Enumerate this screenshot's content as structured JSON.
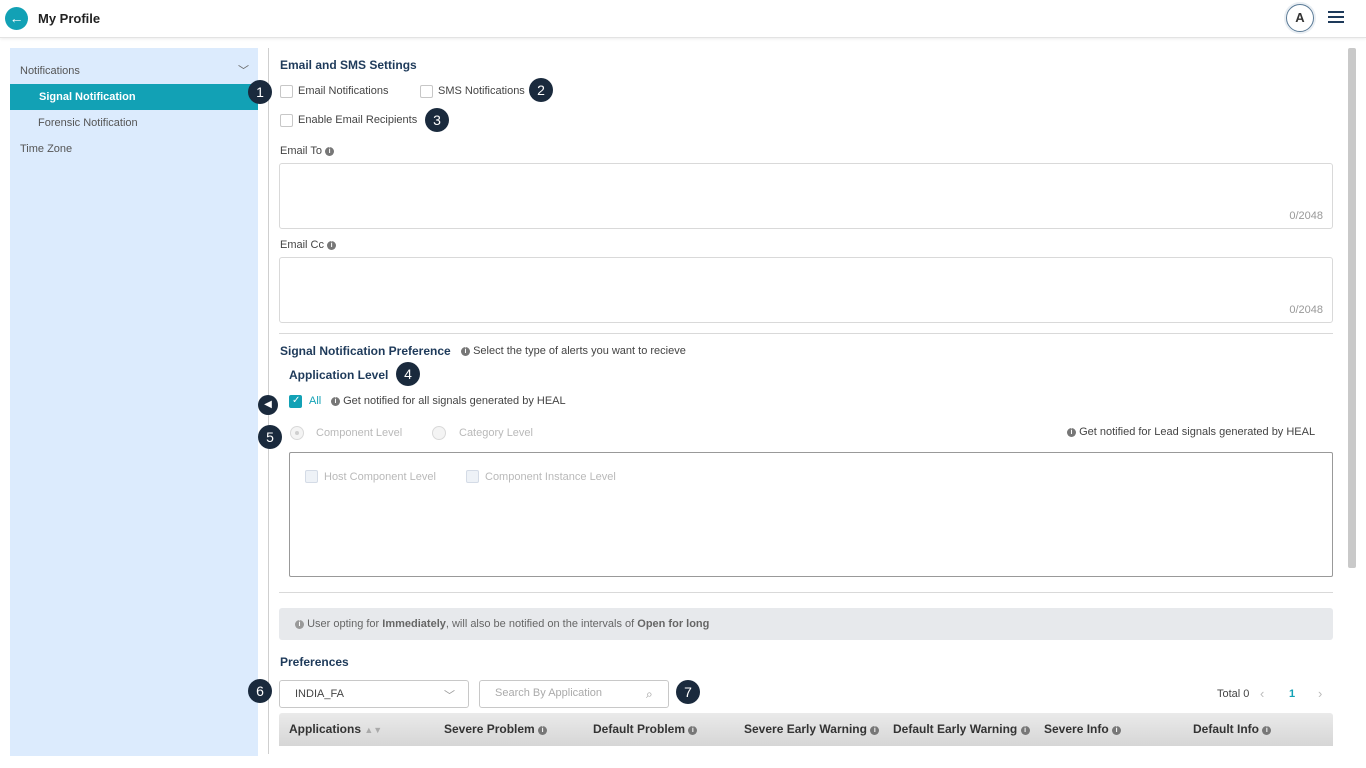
{
  "header": {
    "back_icon": "arrow-left-icon",
    "title": "My Profile",
    "avatar_initial": "A",
    "menu_icon": "hamburger-icon"
  },
  "sidebar": {
    "section": "Notifications",
    "items": [
      "Signal Notification",
      "Forensic Notification"
    ],
    "timezone": "Time Zone"
  },
  "email_sms": {
    "title": "Email and SMS Settings",
    "email_notifications": "Email Notifications",
    "sms_notifications": "SMS Notifications",
    "enable_recipients": "Enable Email Recipients",
    "email_to_label": "Email To",
    "email_to_counter": "0/2048",
    "email_cc_label": "Email Cc",
    "email_cc_counter": "0/2048"
  },
  "badges": [
    "1",
    "2",
    "3",
    "4",
    "5",
    "6",
    "7"
  ],
  "signal_pref": {
    "title": "Signal Notification Preference",
    "hint": "Select the type of alerts you want to recieve",
    "app_level": "Application Level",
    "all_label": "All",
    "all_hint": "Get notified for all signals generated by HEAL",
    "component_level": "Component Level",
    "category_level": "Category Level",
    "lead_hint": "Get notified for Lead signals generated by HEAL",
    "host_component": "Host Component Level",
    "component_instance": "Component Instance Level"
  },
  "notice": {
    "part1": "User opting for",
    "bold1": "Immediately",
    "part2": ", will also be notified on the intervals of",
    "bold2": "Open for long"
  },
  "preferences": {
    "title": "Preferences",
    "selected_app": "INDIA_FA",
    "search_placeholder": "Search By Application",
    "total": "Total 0",
    "page": "1",
    "columns": [
      "Applications",
      "Severe Problem",
      "Default Problem",
      "Severe Early Warning",
      "Default Early Warning",
      "Severe Info",
      "Default Info"
    ]
  }
}
